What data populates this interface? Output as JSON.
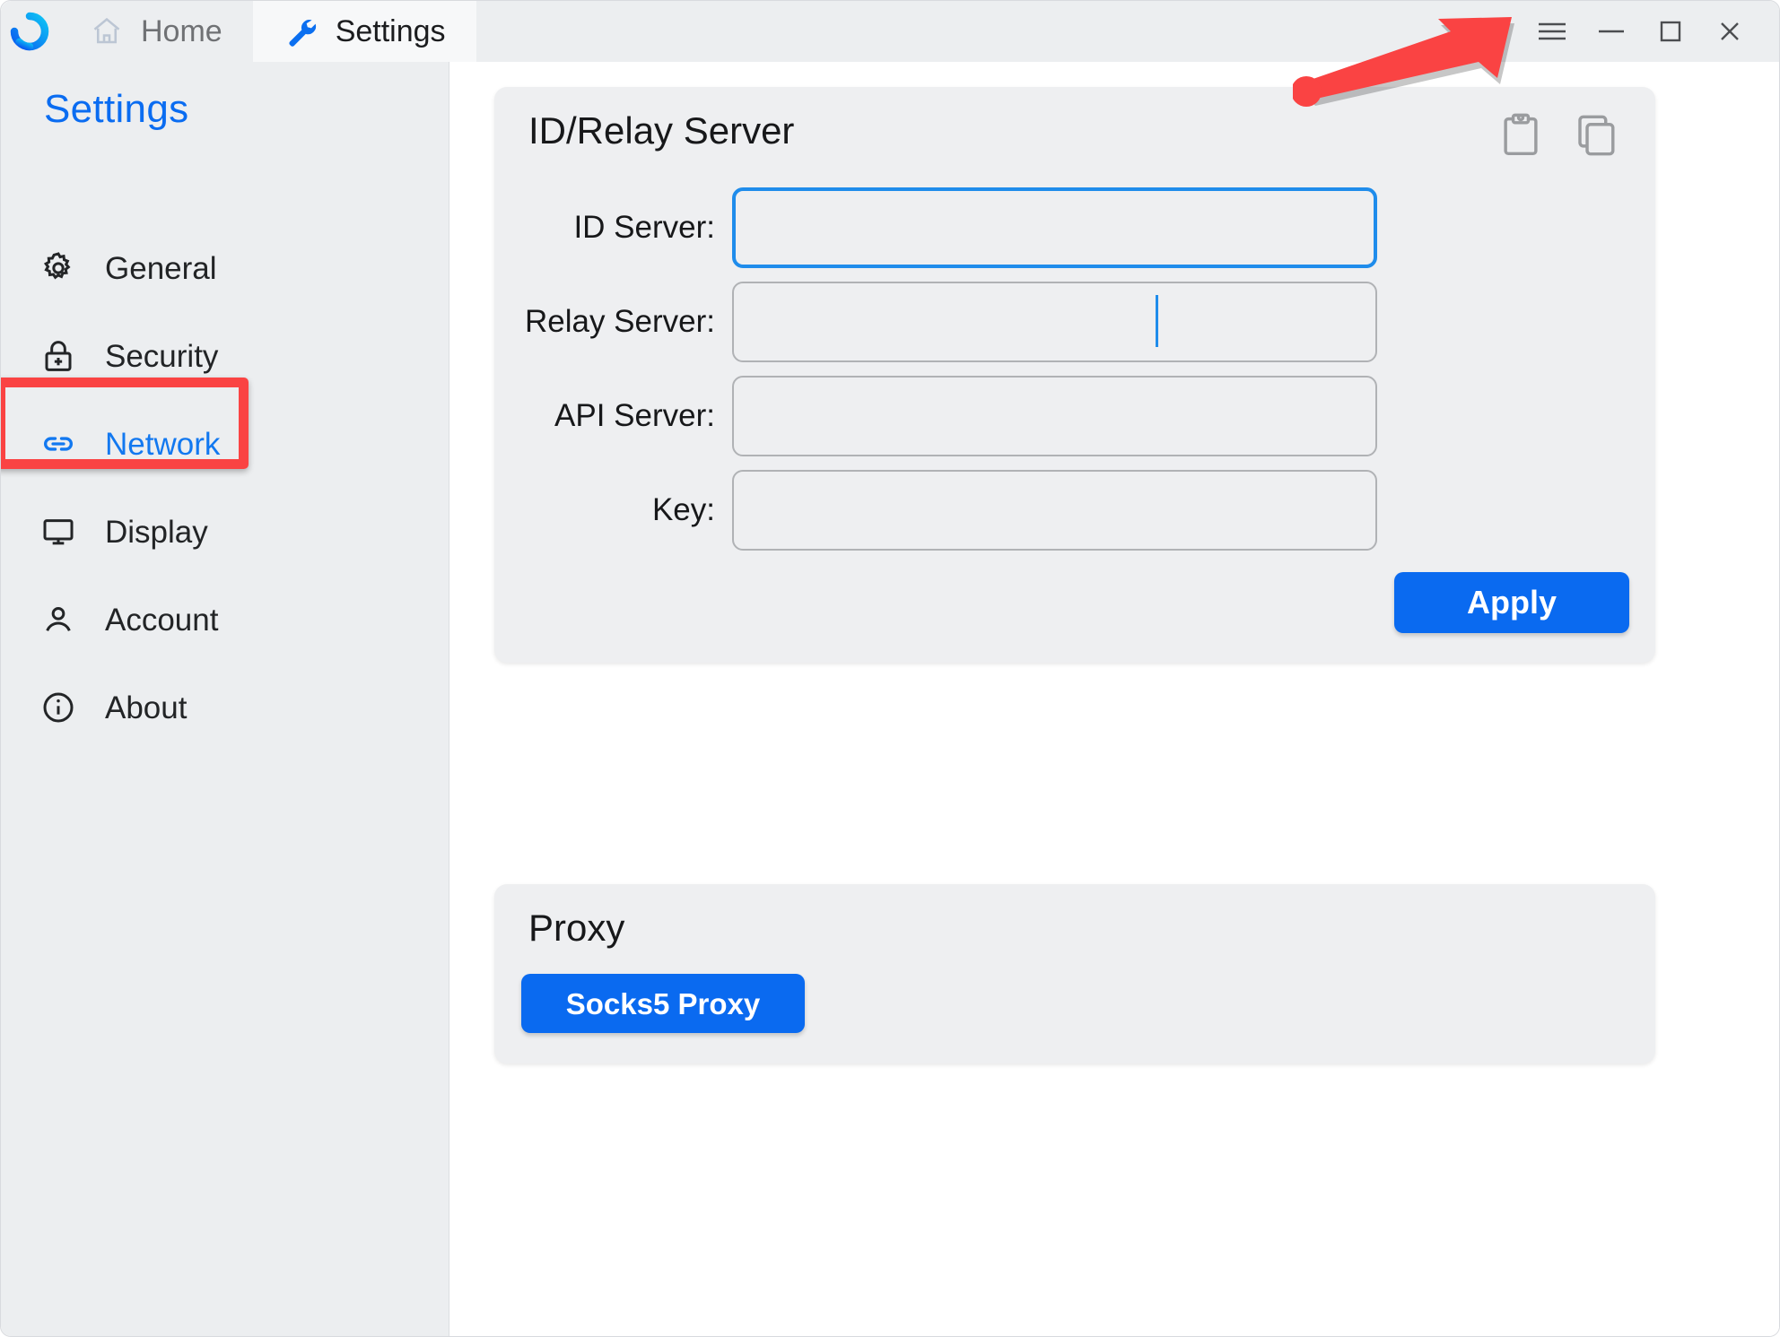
{
  "window": {
    "logo_icon": "rustdesk-logo",
    "controls": [
      {
        "name": "menu-button",
        "icon": "hamburger-icon"
      },
      {
        "name": "minimize-button",
        "icon": "minimize-icon"
      },
      {
        "name": "maximize-button",
        "icon": "maximize-icon"
      },
      {
        "name": "close-button",
        "icon": "close-icon"
      }
    ]
  },
  "tabs": [
    {
      "label": "Home",
      "icon": "home-icon",
      "active": false
    },
    {
      "label": "Settings",
      "icon": "wrench-icon",
      "active": true
    }
  ],
  "sidebar": {
    "title": "Settings",
    "items": [
      {
        "label": "General",
        "icon": "gear-icon",
        "selected": false
      },
      {
        "label": "Security",
        "icon": "lock-icon",
        "selected": false
      },
      {
        "label": "Network",
        "icon": "link-icon",
        "selected": true
      },
      {
        "label": "Display",
        "icon": "monitor-icon",
        "selected": false
      },
      {
        "label": "Account",
        "icon": "person-icon",
        "selected": false
      },
      {
        "label": "About",
        "icon": "info-icon",
        "selected": false
      }
    ]
  },
  "main": {
    "id_relay_card": {
      "title": "ID/Relay Server",
      "actions": [
        {
          "name": "paste-button",
          "icon": "clipboard-icon"
        },
        {
          "name": "copy-button",
          "icon": "copy-icon"
        }
      ],
      "fields": [
        {
          "label": "ID Server:",
          "value": "",
          "placeholder": "",
          "focused": true
        },
        {
          "label": "Relay Server:",
          "value": "",
          "placeholder": "",
          "focused": false
        },
        {
          "label": "API Server:",
          "value": "",
          "placeholder": "",
          "focused": false
        },
        {
          "label": "Key:",
          "value": "",
          "placeholder": "",
          "focused": false
        }
      ],
      "apply_label": "Apply"
    },
    "proxy_card": {
      "title": "Proxy",
      "socks5_label": "Socks5 Proxy"
    }
  },
  "annotations": {
    "arrow": {
      "color": "#fa4343",
      "points_to": "menu-button"
    },
    "highlight_box": {
      "color": "#fa4343",
      "target": "sidebar-item-network"
    }
  },
  "colors": {
    "accent": "#0a6af0",
    "focus_border": "#1f8ceb",
    "annotation": "#fa4343",
    "card_bg": "#eeeff1",
    "sidebar_bg": "#eceef0"
  }
}
